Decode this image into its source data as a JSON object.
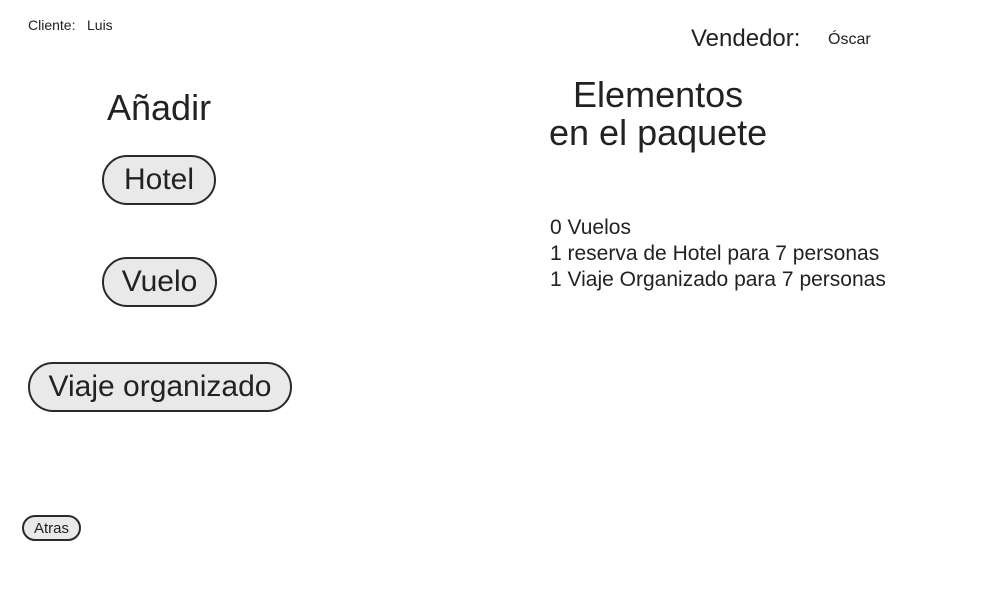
{
  "header": {
    "client_label": "Cliente:",
    "client_name": "Luis",
    "seller_label": "Vendedor:",
    "seller_name": "Óscar"
  },
  "add_section": {
    "title": "Añadir",
    "buttons": {
      "hotel": "Hotel",
      "flight": "Vuelo",
      "organized_trip": "Viaje organizado"
    }
  },
  "package_section": {
    "title_line1": "Elementos",
    "title_line2": "en el paquete",
    "items": [
      "0 Vuelos",
      "1 reserva de Hotel para 7 personas",
      "1 Viaje Organizado para 7 personas"
    ]
  },
  "footer": {
    "back_label": "Atras"
  }
}
